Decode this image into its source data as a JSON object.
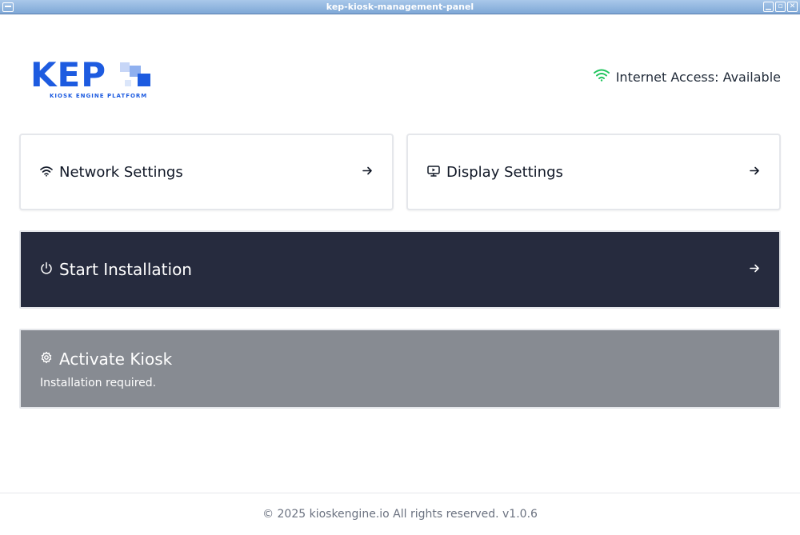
{
  "window": {
    "title": "kep-kiosk-management-panel",
    "controls": [
      "minimize",
      "maximize",
      "close"
    ]
  },
  "logo": {
    "text": "KEP",
    "subtitle": "KIOSK ENGINE PLATFORM",
    "color": "#1d5be0"
  },
  "status": {
    "icon": "wifi-icon",
    "text": "Internet Access: Available",
    "icon_color": "#22c55e"
  },
  "cards": {
    "network": {
      "label": "Network Settings",
      "icon": "wifi-icon"
    },
    "display": {
      "label": "Display Settings",
      "icon": "monitor-play-icon"
    },
    "install": {
      "label": "Start Installation",
      "icon": "power-icon",
      "bg": "#262b3e"
    },
    "activate": {
      "label": "Activate Kiosk",
      "icon": "gear-icon",
      "subtitle": "Installation required.",
      "bg": "#878b92"
    }
  },
  "footer": {
    "text": "© 2025 kioskengine.io All rights reserved. v1.0.6"
  }
}
